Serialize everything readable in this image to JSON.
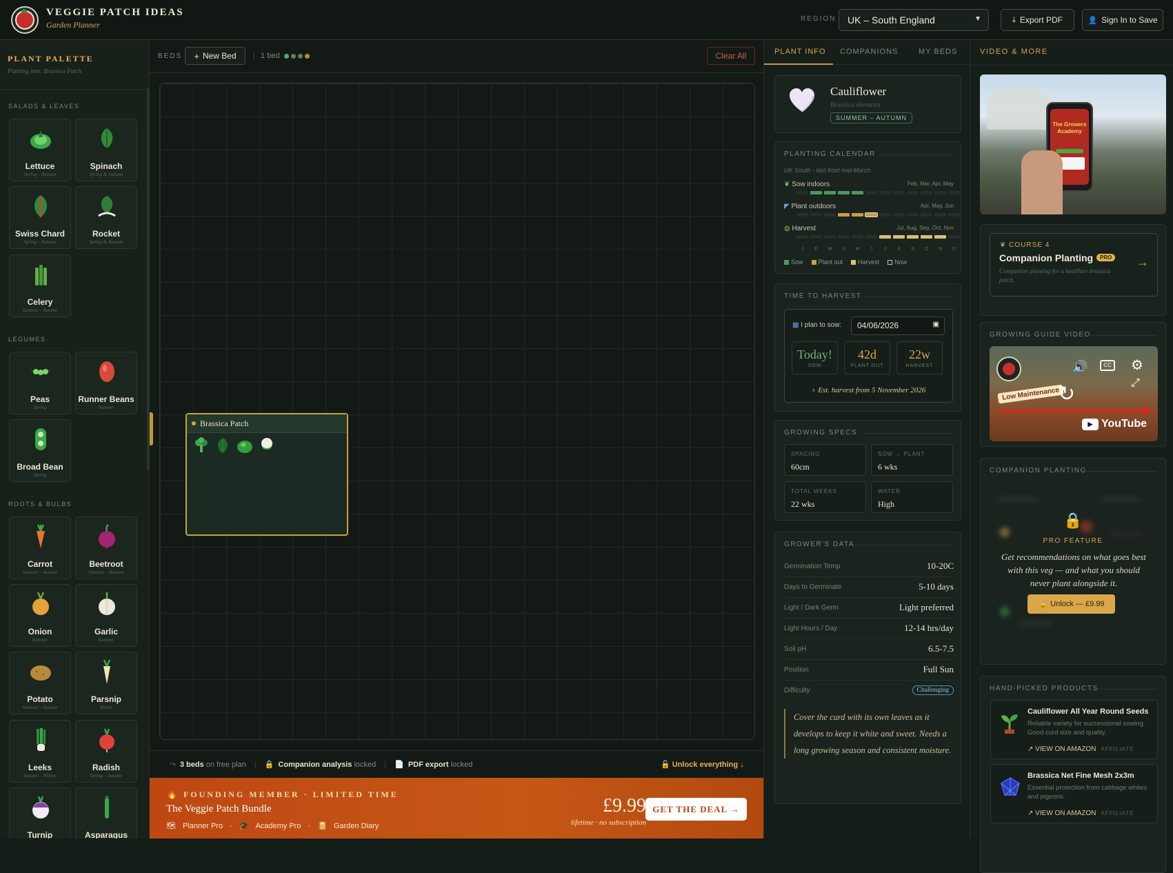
{
  "header": {
    "brand_title": "VEGGIE PATCH IDEAS",
    "brand_subtitle": "Garden Planner",
    "region_label": "REGION",
    "region_value": "UK – South England",
    "export_label": "Export PDF",
    "signin_label": "Sign In to Save"
  },
  "palette": {
    "title": "PLANT PALETTE",
    "subtitle": "Planting into: Brassica Patch",
    "categories": [
      {
        "name": "SALADS & LEAVES",
        "plants": [
          {
            "name": "Lettuce",
            "season": "Spring – Autumn",
            "icon": "lettuce-icon"
          },
          {
            "name": "Spinach",
            "season": "Spring & Autumn",
            "icon": "spinach-icon"
          },
          {
            "name": "Swiss Chard",
            "season": "Spring – Autumn",
            "icon": "chard-icon"
          },
          {
            "name": "Rocket",
            "season": "Spring & Autumn",
            "icon": "rocket-icon"
          },
          {
            "name": "Celery",
            "season": "Summer – Autumn",
            "icon": "celery-icon"
          }
        ]
      },
      {
        "name": "LEGUMES",
        "plants": [
          {
            "name": "Peas",
            "season": "Spring",
            "icon": "peas-icon"
          },
          {
            "name": "Runner Beans",
            "season": "Summer",
            "icon": "runner-bean-icon"
          },
          {
            "name": "Broad Bean",
            "season": "Spring",
            "icon": "broad-bean-icon"
          }
        ]
      },
      {
        "name": "ROOTS & BULBS",
        "plants": [
          {
            "name": "Carrot",
            "season": "Summer – Autumn",
            "icon": "carrot-icon"
          },
          {
            "name": "Beetroot",
            "season": "Summer – Autumn",
            "icon": "beetroot-icon"
          },
          {
            "name": "Onion",
            "season": "Summer",
            "icon": "onion-icon"
          },
          {
            "name": "Garlic",
            "season": "Summer",
            "icon": "garlic-icon"
          },
          {
            "name": "Potato",
            "season": "Summer – Autumn",
            "icon": "potato-icon"
          },
          {
            "name": "Parsnip",
            "season": "Winter",
            "icon": "parsnip-icon"
          },
          {
            "name": "Leeks",
            "season": "Autumn – Winter",
            "icon": "leeks-icon"
          },
          {
            "name": "Radish",
            "season": "Spring – Autumn",
            "icon": "radish-icon"
          },
          {
            "name": "Turnip",
            "season": "",
            "icon": "turnip-icon"
          },
          {
            "name": "Asparagus",
            "season": "",
            "icon": "asparagus-icon"
          }
        ]
      }
    ]
  },
  "toolbar": {
    "beds_label": "BEDS",
    "new_bed_label": "New Bed",
    "bed_count": "1 bed",
    "clear_label": "Clear All"
  },
  "bed": {
    "name": "Brassica Patch",
    "plants": [
      "broccoli-icon",
      "cabbage-leaf-icon",
      "sprout-icon",
      "cauliflower-icon"
    ]
  },
  "plan_footer": {
    "beds_strong": "3 beds",
    "beds_rest": "on free plan",
    "companion_strong": "Companion analysis",
    "companion_rest": "locked",
    "pdf_strong": "PDF export",
    "pdf_rest": "locked",
    "unlock": "Unlock everything"
  },
  "promo": {
    "kicker": "FOUNDING MEMBER · LIMITED TIME",
    "title": "The Veggie Patch Bundle",
    "items": [
      "Planner Pro",
      "Academy Pro",
      "Garden Diary"
    ],
    "price": "£9.99",
    "price_sub": "lifetime · no subscription",
    "cta": "GET THE DEAL →"
  },
  "info_tabs": [
    "PLANT INFO",
    "COMPANIONS",
    "MY BEDS"
  ],
  "plant": {
    "name": "Cauliflower",
    "latin": "Brassica oleracea",
    "season": "SUMMER – AUTUMN"
  },
  "calendar": {
    "title": "PLANTING CALENDAR",
    "subtitle": "UK South - last frost mid-March",
    "rows": [
      {
        "label": "Sow indoors",
        "months": "Feb, Mar, Apr, May",
        "active": [
          1,
          2,
          3,
          4
        ],
        "color": "#4a9a62"
      },
      {
        "label": "Plant outdoors",
        "months": "Apr, May, Jun",
        "active": [
          3,
          4,
          5
        ],
        "color": "#c9a040"
      },
      {
        "label": "Harvest",
        "months": "Jul, Aug, Sep, Oct, Nov",
        "active": [
          6,
          7,
          8,
          9,
          10
        ],
        "color": "#d8c07a"
      }
    ],
    "current_month": 5,
    "month_letters": [
      "J",
      "F",
      "M",
      "A",
      "M",
      "J",
      "J",
      "A",
      "S",
      "O",
      "N",
      "D"
    ],
    "legend": [
      "Sow",
      "Plant out",
      "Harvest",
      "Now"
    ]
  },
  "harvest": {
    "title": "TIME TO HARVEST",
    "sow_label": "I plan to sow:",
    "sow_date": "04/06/2026",
    "stats": [
      {
        "value": "Today!",
        "label": "SOW",
        "color": "#6db27f"
      },
      {
        "value": "42d",
        "label": "PLANT OUT",
        "color": "#d9a74a"
      },
      {
        "value": "22w",
        "label": "HARVEST",
        "color": "#d9a74a"
      }
    ],
    "estimate": "Est. harvest from 5 November 2026"
  },
  "specs": {
    "title": "GROWING SPECS",
    "items": [
      {
        "label": "SPACING",
        "value": "60cm"
      },
      {
        "label": "SOW → PLANT",
        "value": "6 wks"
      },
      {
        "label": "TOTAL WEEKS",
        "value": "22 wks"
      },
      {
        "label": "WATER",
        "value": "High"
      }
    ]
  },
  "grower": {
    "title": "GROWER'S DATA",
    "rows": [
      {
        "label": "Germination Temp",
        "value": "10-20C"
      },
      {
        "label": "Days to Germinate",
        "value": "5-10 days"
      },
      {
        "label": "Light / Dark Germ",
        "value": "Light preferred"
      },
      {
        "label": "Light Hours / Day",
        "value": "12-14 hrs/day"
      },
      {
        "label": "Soil pH",
        "value": "6.5-7.5"
      },
      {
        "label": "Position",
        "value": "Full Sun"
      }
    ],
    "difficulty_label": "Difficulty",
    "difficulty_value": "Challenging",
    "tip": "Cover the curd with its own leaves as it develops to keep it white and sweet. Needs a long growing season and consistent moisture."
  },
  "right": {
    "title": "VIDEO & MORE",
    "thumb_text": "The Growers Academy",
    "course_kicker": "COURSE 4",
    "course_title": "Companion Planting",
    "course_badge": "PRO",
    "course_desc": "Companion planting for a healthier brassica patch.",
    "video_title": "GROWING GUIDE VIDEO",
    "video_overlay": "Low Maintenance",
    "video_channel": "YouTube",
    "companion_title": "COMPANION PLANTING",
    "pro_label": "PRO FEATURE",
    "pro_desc": "Get recommendations on what goes best with this veg — and what you should never plant alongside it.",
    "unlock": "Unlock — £9.99",
    "products_title": "HAND-PICKED PRODUCTS",
    "products": [
      {
        "title": "Cauliflower All Year Round Seeds",
        "desc": "Reliable variety for successional sowing. Good curd size and quality.",
        "link": "VIEW ON AMAZON",
        "tag": "AFFILIATE",
        "icon": "seedling-icon"
      },
      {
        "title": "Brassica Net Fine Mesh 2x3m",
        "desc": "Essential protection from cabbage whites and pigeons.",
        "link": "VIEW ON AMAZON",
        "tag": "AFFILIATE",
        "icon": "net-icon"
      }
    ]
  }
}
